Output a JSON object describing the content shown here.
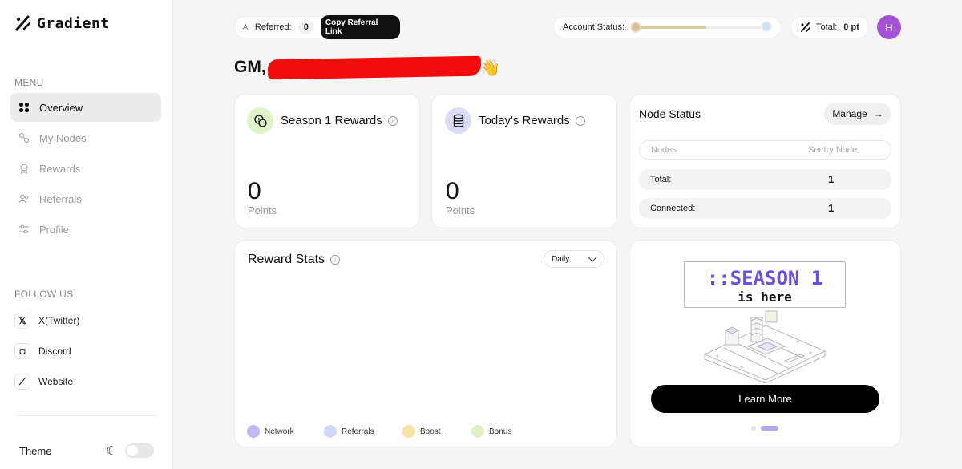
{
  "brand": {
    "name": "Gradient"
  },
  "sidebar": {
    "menu_label": "MENU",
    "items": [
      {
        "label": "Overview",
        "icon": "grid-icon",
        "active": true
      },
      {
        "label": "My Nodes",
        "icon": "nodes-icon"
      },
      {
        "label": "Rewards",
        "icon": "award-icon"
      },
      {
        "label": "Referrals",
        "icon": "users-icon"
      },
      {
        "label": "Profile",
        "icon": "sliders-icon"
      }
    ],
    "follow_label": "FOLLOW US",
    "social": [
      {
        "label": "X(Twitter)",
        "icon": "x-icon",
        "glyph": "𝕏"
      },
      {
        "label": "Discord",
        "icon": "discord-icon",
        "glyph": "◘"
      },
      {
        "label": "Website",
        "icon": "gradient-logo-icon",
        "glyph": "⟋"
      }
    ],
    "theme_label": "Theme"
  },
  "topbar": {
    "referred_label": "Referred:",
    "referred_count": "0",
    "copy_label": "Copy Referral Link",
    "account_status_label": "Account Status:",
    "total_label": "Total:",
    "total_value": "0 pt",
    "avatar_letter": "H"
  },
  "greeting": {
    "prefix": "GM,",
    "wave": "👋"
  },
  "cards": {
    "season": {
      "title": "Season 1 Rewards",
      "value": "0",
      "unit": "Points"
    },
    "today": {
      "title": "Today's Rewards",
      "value": "0",
      "unit": "Points"
    }
  },
  "node_status": {
    "title": "Node Status",
    "manage_label": "Manage",
    "manage_arrow": "→",
    "col_nodes": "Nodes",
    "col_sentry": "Sentry Node",
    "rows": [
      {
        "label": "Total:",
        "value": "1"
      },
      {
        "label": "Connected:",
        "value": "1"
      }
    ]
  },
  "reward_stats": {
    "title": "Reward Stats",
    "period": "Daily",
    "legend": [
      {
        "label": "Network",
        "color": "#c4b8f2"
      },
      {
        "label": "Referrals",
        "color": "#d4d6f7"
      },
      {
        "label": "Boost",
        "color": "#f6e2a3"
      },
      {
        "label": "Bonus",
        "color": "#dff0c6"
      }
    ]
  },
  "promo": {
    "line1": "::SEASON 1",
    "line2": "is here",
    "button": "Learn More"
  }
}
